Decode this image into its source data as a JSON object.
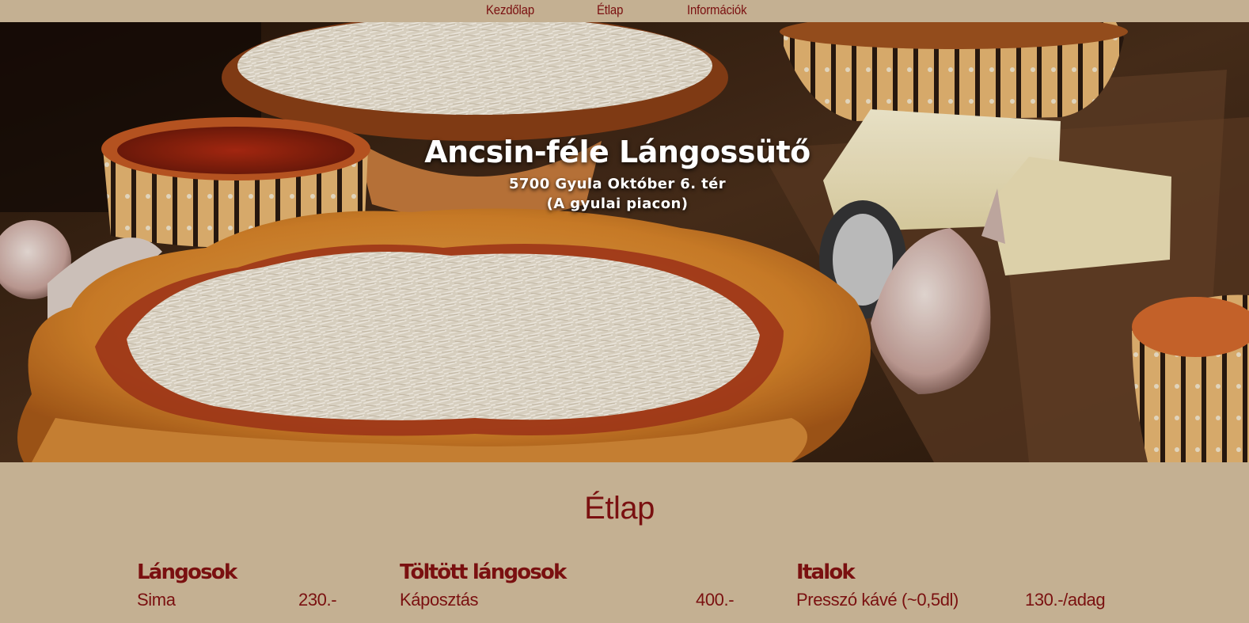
{
  "nav": {
    "items": [
      {
        "label": "Kezdőlap"
      },
      {
        "label": "Étlap"
      },
      {
        "label": "Információk"
      }
    ]
  },
  "hero": {
    "title": "Ancsin-féle Lángossütő",
    "address": "5700 Gyula Október 6. tér",
    "note": "(A gyulai piacon)"
  },
  "menu": {
    "title": "Étlap",
    "columns": [
      {
        "heading": "Lángosok",
        "items": [
          {
            "name": "Sima",
            "price": "230.-"
          }
        ]
      },
      {
        "heading": "Töltött lángosok",
        "items": [
          {
            "name": "Káposztás",
            "price": "400.-"
          }
        ]
      },
      {
        "heading": "Italok",
        "items": [
          {
            "name": "Presszó kávé (~0,5dl)",
            "price": "130.-/adag"
          }
        ]
      }
    ]
  },
  "colors": {
    "background": "#c4b092",
    "accent": "#7a1010",
    "hero_text": "#ffffff"
  }
}
